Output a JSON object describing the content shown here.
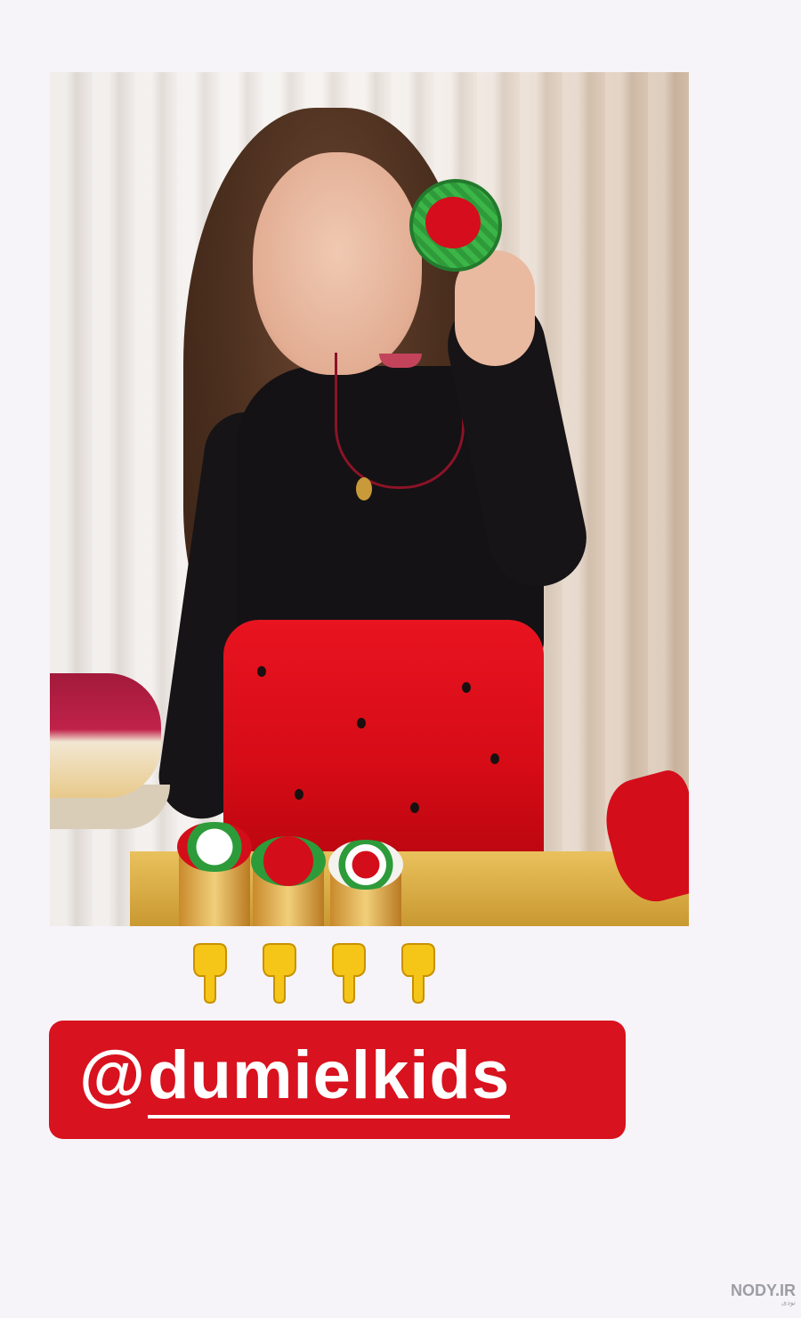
{
  "story": {
    "photo": {
      "subject": "girl-holding-cookie"
    },
    "emoji_row": {
      "icons": [
        "backhand-index-pointing-down-icon",
        "backhand-index-pointing-down-icon",
        "backhand-index-pointing-down-icon",
        "backhand-index-pointing-down-icon"
      ]
    },
    "mention": {
      "at_sign": "@",
      "username": "dumielkids",
      "background_color": "#d8121e",
      "text_color": "#ffffff"
    },
    "watermark": {
      "logo_text": "NODY.IR",
      "subtitle": "نودی"
    }
  }
}
